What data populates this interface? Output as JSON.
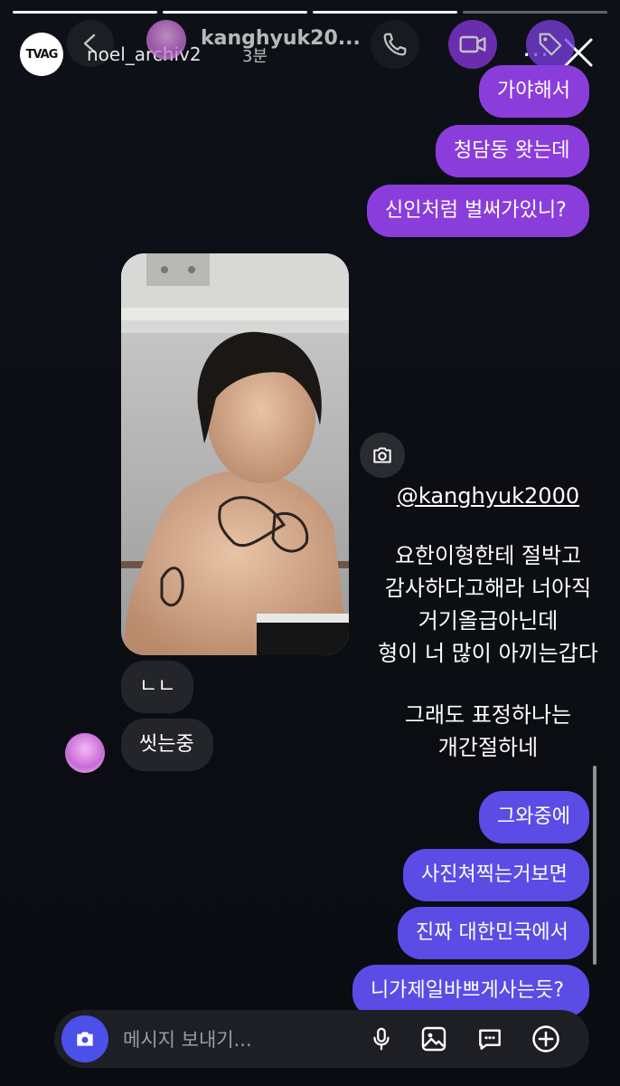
{
  "story": {
    "username": "noel_archiv2",
    "time": "3분",
    "avatar_text": "TVAG",
    "more": "···",
    "progress_segments": 4,
    "progress_done": 3
  },
  "dm": {
    "name": "kanghyuk20..."
  },
  "messages_top": [
    {
      "text": "가야해서"
    },
    {
      "text": "청담동 왓는데"
    },
    {
      "text": "신인처럼 벌써가있니?"
    }
  ],
  "incoming": [
    {
      "text": "ㄴㄴ"
    },
    {
      "text": "씻는중"
    }
  ],
  "overlay": {
    "mention": "@kanghyuk2000",
    "lines": [
      "요한이형한테 절박고",
      "감사하다고해라 너아직",
      "거기올급아닌데",
      "형이 너 많이 아끼는갑다"
    ],
    "lines2": [
      "그래도 표정하나는",
      "개간절하네"
    ]
  },
  "messages_bottom": [
    {
      "text": "그와중에"
    },
    {
      "text": "사진쳐찍는거보면"
    },
    {
      "text": "진짜 대한민국에서"
    },
    {
      "text": "니가제일바쁘게사는듯?"
    }
  ],
  "composer": {
    "placeholder": "메시지 보내기..."
  },
  "colors": {
    "outgoing_purple": "#8b3ddc",
    "outgoing_blue": "#5b4ce6",
    "incoming": "#23252b",
    "background": "#0b0d12"
  }
}
